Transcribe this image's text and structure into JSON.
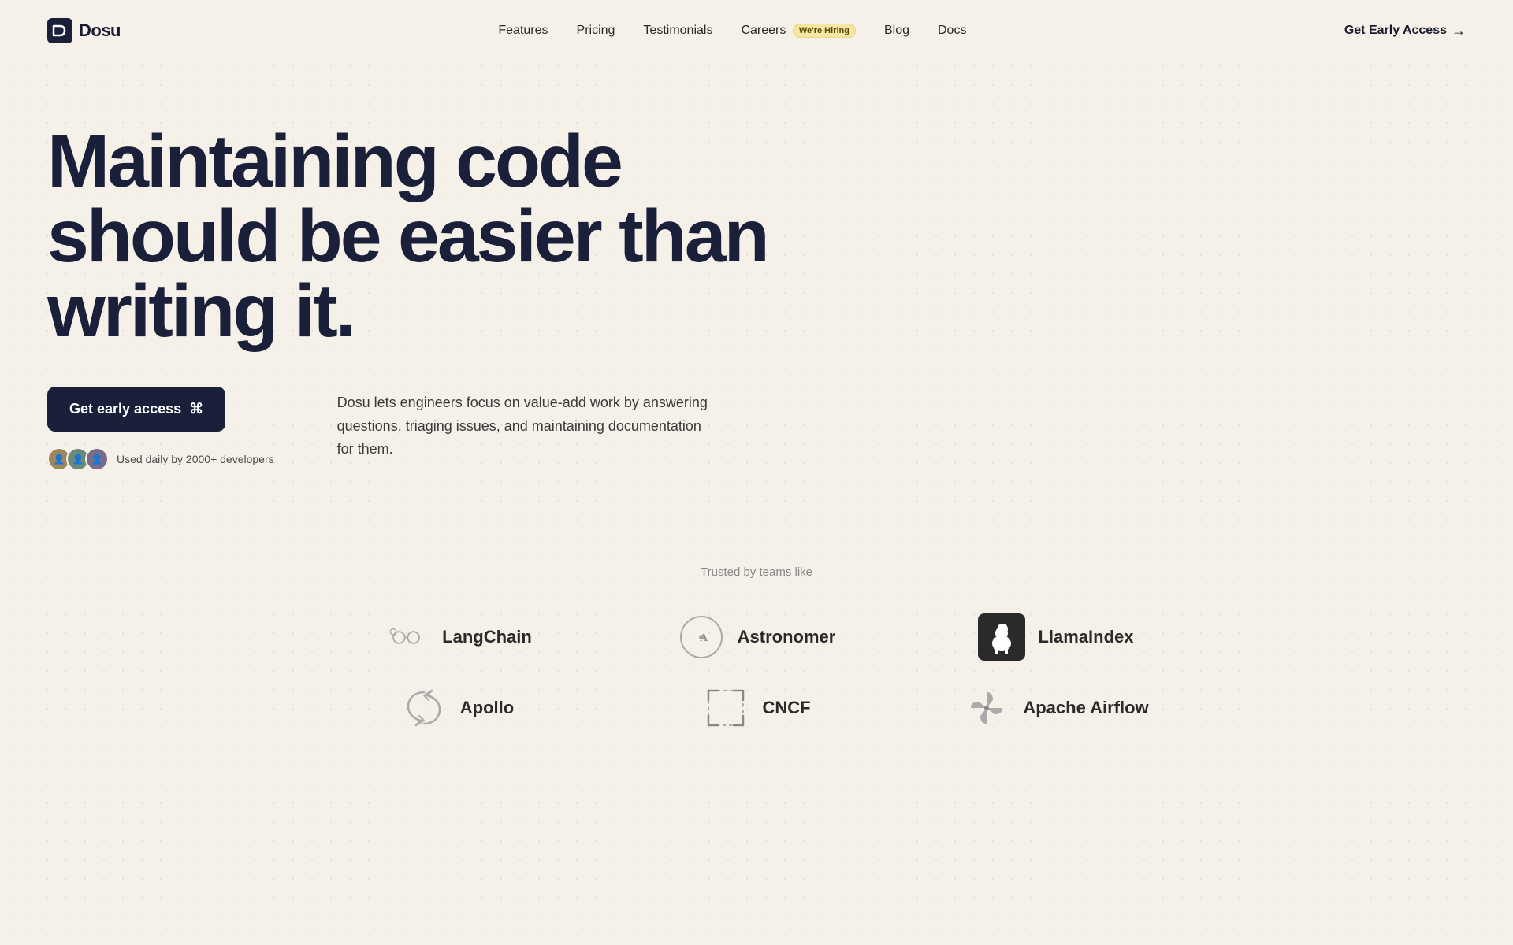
{
  "nav": {
    "logo_text": "Dosu",
    "links": [
      {
        "id": "features",
        "label": "Features"
      },
      {
        "id": "pricing",
        "label": "Pricing"
      },
      {
        "id": "testimonials",
        "label": "Testimonials"
      },
      {
        "id": "careers",
        "label": "Careers",
        "badge": "We're Hiring"
      },
      {
        "id": "blog",
        "label": "Blog"
      },
      {
        "id": "docs",
        "label": "Docs"
      }
    ],
    "cta_label": "Get Early Access"
  },
  "hero": {
    "headline": "Maintaining code should be easier than writing it.",
    "cta_label": "Get early access",
    "social_proof": "Used daily by 2000+ developers",
    "description": "Dosu lets engineers focus on value-add work by answering questions, triaging issues, and maintaining documentation for them."
  },
  "trusted": {
    "label": "Trusted by teams like",
    "companies": [
      {
        "id": "langchain",
        "name": "LangChain"
      },
      {
        "id": "astronomer",
        "name": "Astronomer"
      },
      {
        "id": "llamaindex",
        "name": "LlamaIndex"
      },
      {
        "id": "apollo",
        "name": "Apollo"
      },
      {
        "id": "cncf",
        "name": "CNCF"
      },
      {
        "id": "airflow",
        "name": "Apache Airflow"
      }
    ]
  },
  "colors": {
    "background": "#f5f0e8",
    "nav_cta_text": "#1a1f3a",
    "button_bg": "#1a1f3a",
    "heading": "#1a1f3a",
    "hiring_badge_bg": "#f5e6a3"
  }
}
